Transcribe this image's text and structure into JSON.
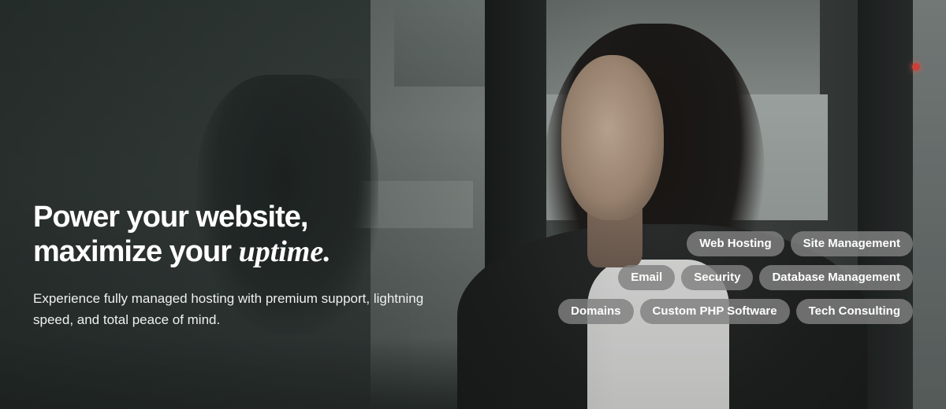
{
  "hero": {
    "headline_line1": "Power your website,",
    "headline_line2_prefix": "maximize your ",
    "headline_line2_accent": "uptime.",
    "subtext": "Experience fully managed hosting with premium support, lightning speed, and total peace of mind."
  },
  "tags": {
    "row1": [
      "Web Hosting",
      "Site Management"
    ],
    "row2": [
      "Email",
      "Security",
      "Database Management"
    ],
    "row3": [
      "Domains",
      "Custom PHP Software",
      "Tech Consulting"
    ]
  },
  "colors": {
    "text": "#ffffff",
    "tag_background": "#808080",
    "indicator_light": "#e0443a"
  }
}
